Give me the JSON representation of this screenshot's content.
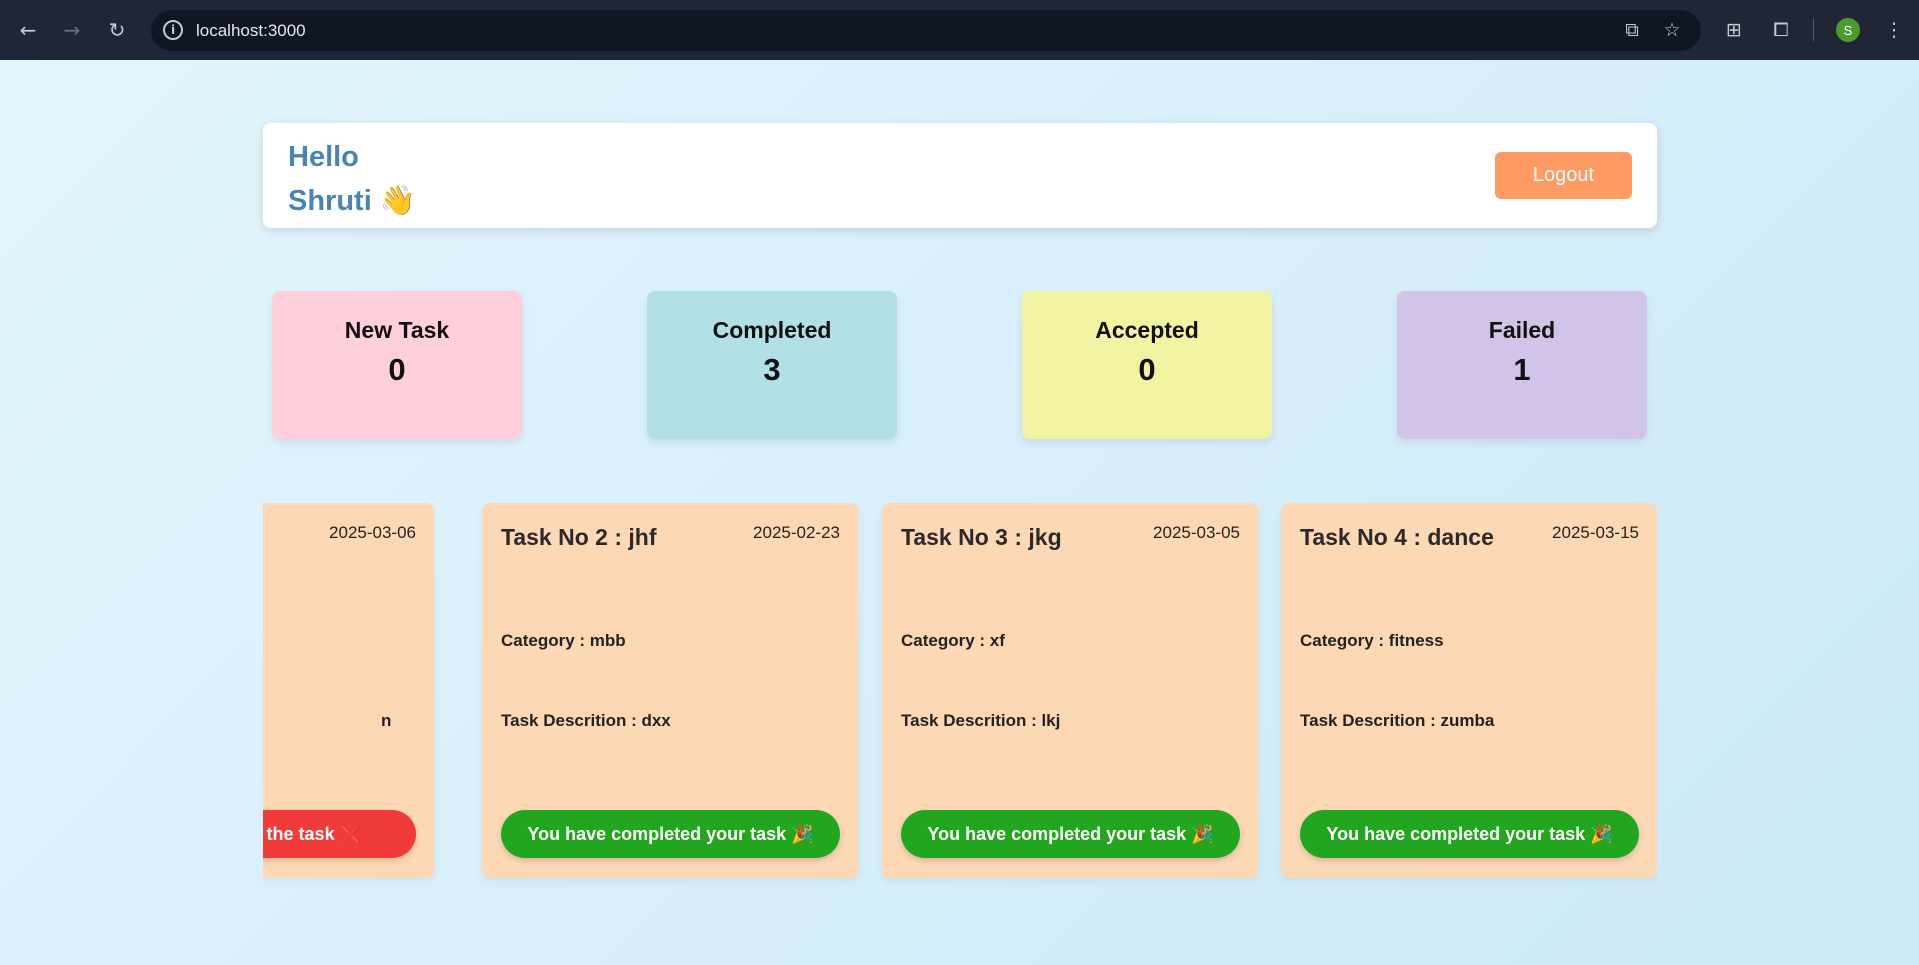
{
  "browser": {
    "url": "localhost:3000",
    "profile_initial": "S",
    "icons": {
      "back": "arrow-left-icon",
      "forward": "arrow-right-icon",
      "reload": "reload-icon",
      "site_info": "info-icon",
      "open_external": "external-link-icon",
      "bookmark": "star-icon",
      "extensions_a": "qr-grid-icon",
      "extensions_b": "puzzle-icon",
      "menu": "kebab-menu-icon"
    }
  },
  "header": {
    "greeting_line1": "Hello",
    "greeting_line2": "Shruti 👋",
    "logout_label": "Logout"
  },
  "stats": [
    {
      "label": "New Task",
      "count": "0",
      "color": "#ffd0dc"
    },
    {
      "label": "Completed",
      "count": "3",
      "color": "#b1e0e6"
    },
    {
      "label": "Accepted",
      "count": "0",
      "color": "#f1f3a3"
    },
    {
      "label": "Failed",
      "count": "1",
      "color": "#d1c4e8"
    }
  ],
  "tasks": [
    {
      "title": "",
      "date": "2025-03-06",
      "category": "",
      "description": "n",
      "status": "ed the task ❌",
      "status_type": "failed"
    },
    {
      "title": "Task No 2 : jhf",
      "date": "2025-02-23",
      "category": "Category : mbb",
      "description": "Task Descrition : dxx",
      "status": "You have completed your task 🎉",
      "status_type": "completed"
    },
    {
      "title": "Task No 3 : jkg",
      "date": "2025-03-05",
      "category": "Category : xf",
      "description": "Task Descrition : lkj",
      "status": "You have completed your task 🎉",
      "status_type": "completed"
    },
    {
      "title": "Task No 4 : dance",
      "date": "2025-03-15",
      "category": "Category : fitness",
      "description": "Task Descrition : zumba",
      "status": "You have completed your task 🎉",
      "status_type": "completed"
    }
  ],
  "colors": {
    "completed": "#22a61f",
    "failed": "#f13a3a",
    "task_card": "#fdd8b5",
    "accent": "#fd9b62"
  }
}
